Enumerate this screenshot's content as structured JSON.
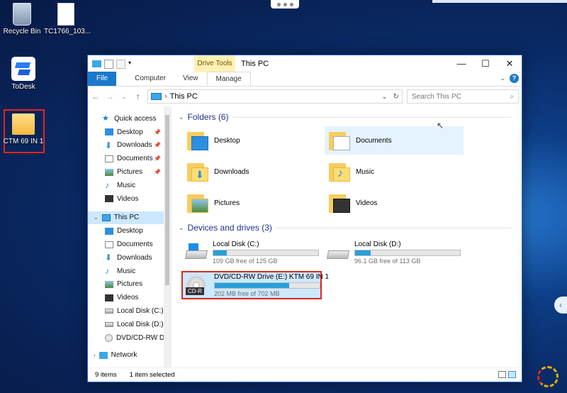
{
  "desktop": {
    "icons": [
      {
        "label": "Recycle Bin"
      },
      {
        "label": "TC1766_103..."
      },
      {
        "label": "ToDesk"
      },
      {
        "label": "CTM 69 IN 1"
      }
    ]
  },
  "window": {
    "title": "This PC",
    "context_tab": "Drive Tools",
    "ribbon_tabs": [
      "File",
      "Computer",
      "View",
      "Manage"
    ],
    "controls": {
      "minimize": "—",
      "maximize": "☐",
      "close": "✕"
    },
    "address": {
      "location": "This PC",
      "search_placeholder": "Search This PC"
    },
    "nav": {
      "quick_access": "Quick access",
      "quick_items": [
        "Desktop",
        "Downloads",
        "Documents",
        "Pictures",
        "Music",
        "Videos"
      ],
      "this_pc": "This PC",
      "pc_items": [
        "Desktop",
        "Documents",
        "Downloads",
        "Music",
        "Pictures",
        "Videos",
        "Local Disk (C:)",
        "Local Disk (D:)",
        "DVD/CD-RW Dri"
      ],
      "network": "Network"
    },
    "folders_header": "Folders (6)",
    "folders": [
      "Desktop",
      "Documents",
      "Downloads",
      "Music",
      "Pictures",
      "Videos"
    ],
    "devices_header": "Devices and drives (3)",
    "drives": [
      {
        "name": "Local Disk (C:)",
        "free": "109 GB free of 125 GB",
        "used_fraction": 0.13
      },
      {
        "name": "Local Disk (D:)",
        "free": "96.1 GB free of 113 GB",
        "used_fraction": 0.15
      },
      {
        "name": "DVD/CD-RW Drive (E:) KTM 69 IN 1",
        "free": "202 MB free of 702 MB",
        "used_fraction": 0.71,
        "badge": "CD-R"
      }
    ],
    "status": {
      "items": "9 items",
      "selected": "1 item selected"
    }
  },
  "colors": {
    "accent": "#1979ca",
    "selection": "#cce8ff",
    "highlight_box": "#e0261c",
    "drive_bar": "#26a0da"
  }
}
